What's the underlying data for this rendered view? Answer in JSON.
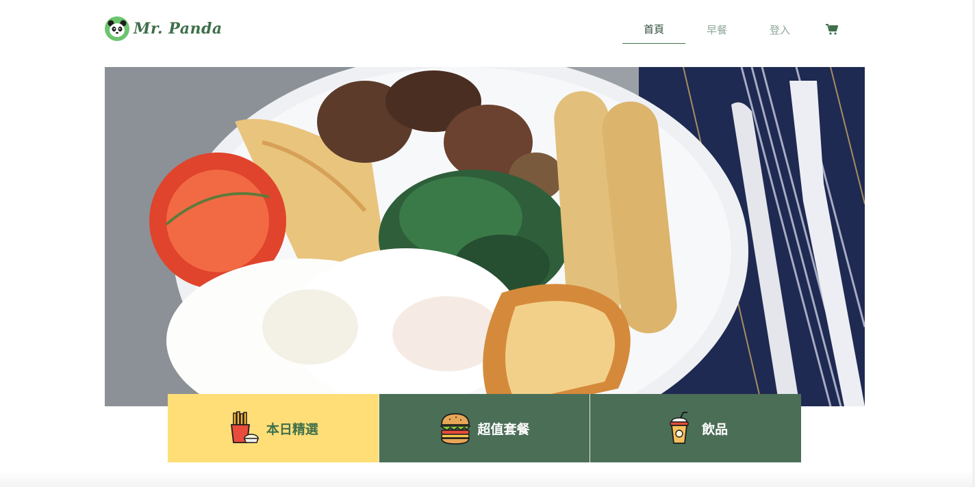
{
  "brand": {
    "name": "Mr. Panda",
    "logo_icon": "panda-face-icon",
    "accent": "#3f6f4b"
  },
  "nav": {
    "items": [
      {
        "label": "首頁",
        "active": true
      },
      {
        "label": "早餐",
        "active": false
      },
      {
        "label": "登入",
        "active": false
      }
    ],
    "cart_icon": "shopping-cart-icon"
  },
  "hero": {
    "image": "breakfast-plate-photo"
  },
  "categories": [
    {
      "label": "本日精選",
      "icon": "fries-icon",
      "color": "#ffde78"
    },
    {
      "label": "超值套餐",
      "icon": "burger-icon",
      "color": "#4b6e57"
    },
    {
      "label": "飲品",
      "icon": "drink-cup-icon",
      "color": "#4b6e57"
    }
  ]
}
